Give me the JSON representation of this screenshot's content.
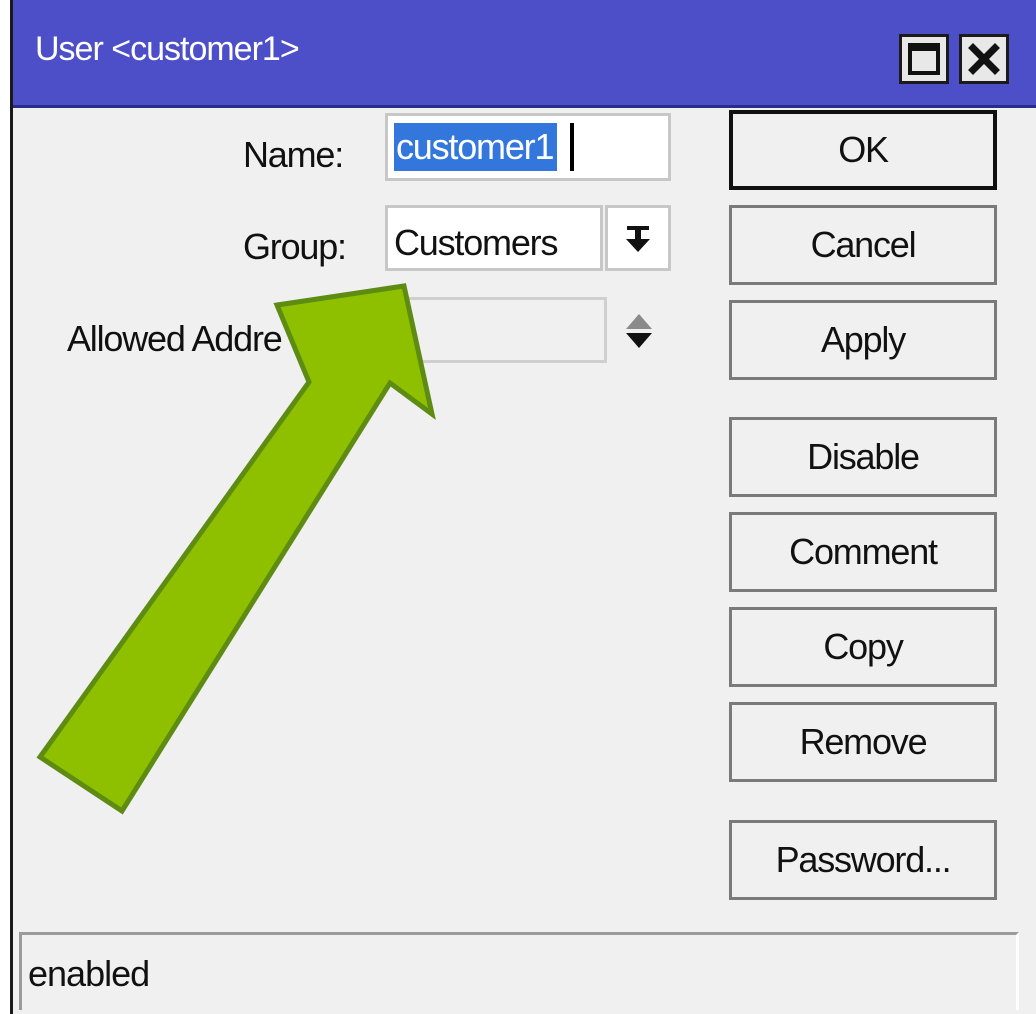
{
  "window": {
    "title": "User <customer1>"
  },
  "form": {
    "name_label": "Name:",
    "name_value": "customer1",
    "group_label": "Group:",
    "group_value": "Customers",
    "allowed_address_label": "Allowed Addre",
    "allowed_address_value": ""
  },
  "buttons": {
    "ok": "OK",
    "cancel": "Cancel",
    "apply": "Apply",
    "disable": "Disable",
    "comment": "Comment",
    "copy": "Copy",
    "remove": "Remove",
    "password": "Password..."
  },
  "status": {
    "text": "enabled"
  },
  "icons": {
    "maximize": "maximize-icon",
    "close": "close-icon",
    "group_dropdown": "dropdown-arrow-icon",
    "address_spinner": "up-down-arrows-icon",
    "annotation": "annotation-arrow-icon"
  },
  "colors": {
    "titlebar": "#4d4fc9",
    "selection": "#3377dd",
    "annotation_arrow": "#8fc000",
    "annotation_arrow_border": "#5e8c12"
  }
}
